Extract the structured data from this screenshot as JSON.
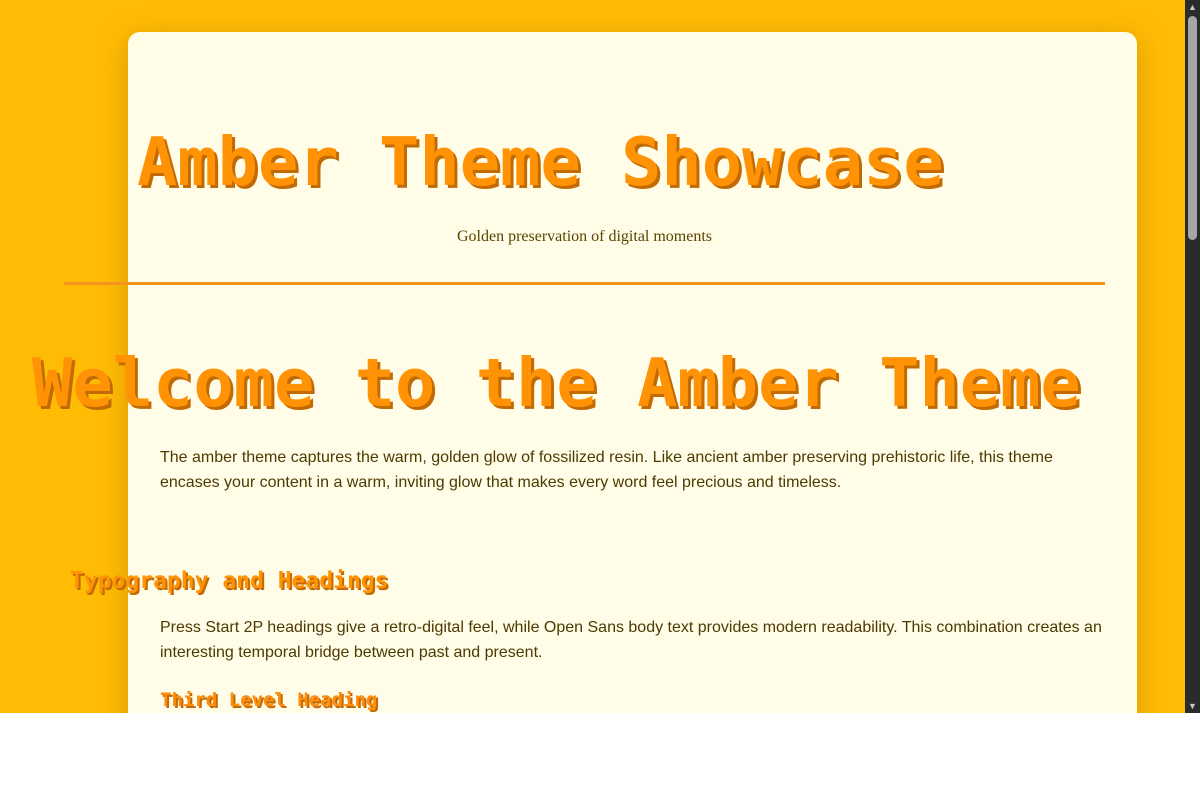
{
  "header": {
    "title": "Amber Theme Showcase",
    "tagline": "Golden preservation of digital moments"
  },
  "main": {
    "heading": "Welcome to the Amber Theme",
    "intro": "The amber theme captures the warm, golden glow of fossilized resin. Like ancient amber preserving prehistoric life, this theme encases your content in a warm, inviting glow that makes every word feel precious and timeless.",
    "section": {
      "heading": "Typography and Headings",
      "body": "Press Start 2P headings give a retro-digital feel, while Open Sans body text provides modern readability. This combination creates an interesting temporal bridge between past and present.",
      "subheading": "Third Level Heading"
    }
  },
  "colors": {
    "page_background": "#ffbc05",
    "card_background": "#fffce7",
    "heading": "#ff9305",
    "heading_shadow": "#c26a04",
    "divider": "#f7941d",
    "body_text": "#4d3a00"
  },
  "scrollbar": {
    "up_icon": "triangle-up-icon",
    "down_icon": "triangle-down-icon"
  }
}
